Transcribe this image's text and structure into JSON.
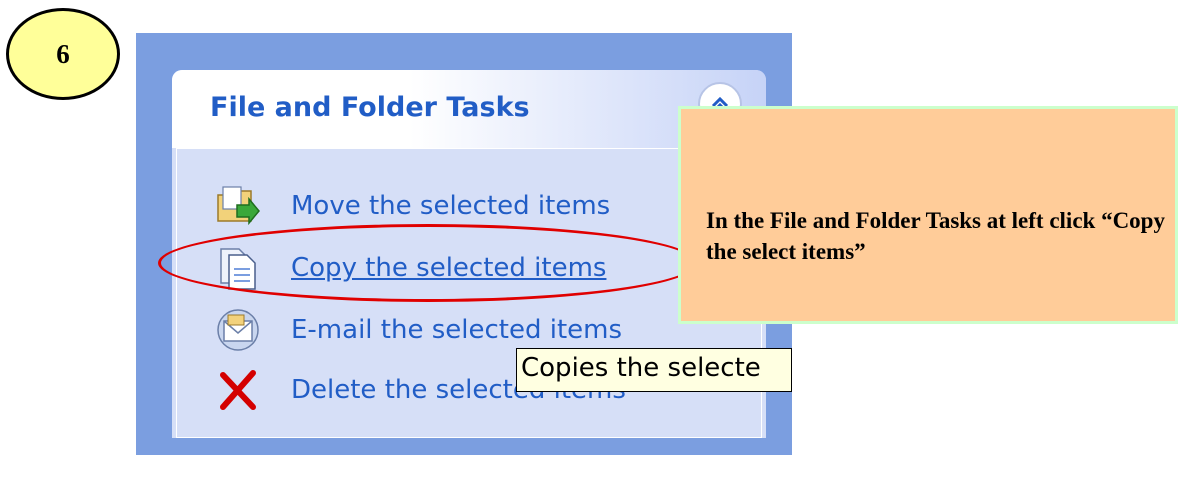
{
  "step_badge": {
    "number": "6"
  },
  "panel": {
    "title": "File and Folder Tasks",
    "tasks": [
      {
        "label": "Move the selected items",
        "icon": "move-folder-icon"
      },
      {
        "label": "Copy the selected items",
        "icon": "copy-document-icon",
        "hovered": true
      },
      {
        "label": "E-mail the selected items",
        "icon": "email-envelope-icon"
      },
      {
        "label": "Delete the selected items",
        "icon": "delete-x-icon"
      }
    ]
  },
  "tooltip": {
    "text": "Copies the selecte"
  },
  "callout": {
    "text": "In the File and Folder Tasks at left click “Copy the select items”"
  },
  "colors": {
    "frame": "#7b9ee0",
    "panel": "#d6dff7",
    "link": "#215dc6",
    "highlight": "#e00000",
    "callout_bg": "#ffcc99",
    "callout_border": "#ccffcc",
    "badge_bg": "#ffff99"
  }
}
